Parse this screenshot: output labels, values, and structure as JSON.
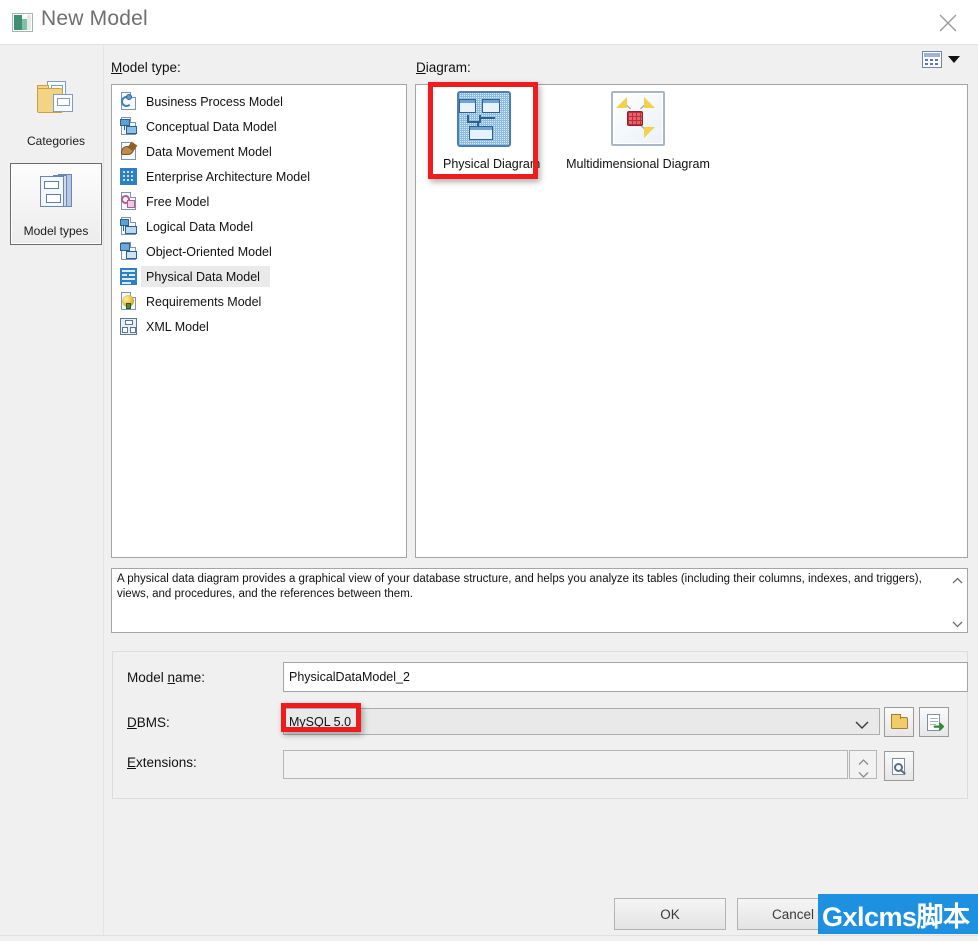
{
  "window": {
    "title": "New Model",
    "title_icon": "model-icon",
    "close_icon": "close-icon"
  },
  "view_mode": {
    "icon": "list-view-icon",
    "arrow_icon": "chevron-down-icon"
  },
  "rail": {
    "items": [
      {
        "label": "Categories",
        "icon": "categories-folder-icon",
        "selected": false
      },
      {
        "label": "Model types",
        "icon": "model-types-icon",
        "selected": true
      }
    ]
  },
  "model_type": {
    "label_prefix": "M",
    "label_rest": "odel type:",
    "items": [
      {
        "label": "Business Process Model",
        "icon": "business-process-model-icon",
        "selected": false
      },
      {
        "label": "Conceptual Data Model",
        "icon": "conceptual-data-model-icon",
        "selected": false
      },
      {
        "label": "Data Movement Model",
        "icon": "data-movement-model-icon",
        "selected": false
      },
      {
        "label": "Enterprise Architecture Model",
        "icon": "enterprise-architecture-model-icon",
        "selected": false
      },
      {
        "label": "Free Model",
        "icon": "free-model-icon",
        "selected": false
      },
      {
        "label": "Logical Data Model",
        "icon": "logical-data-model-icon",
        "selected": false
      },
      {
        "label": "Object-Oriented Model",
        "icon": "object-oriented-model-icon",
        "selected": false
      },
      {
        "label": "Physical Data Model",
        "icon": "physical-data-model-icon",
        "selected": true
      },
      {
        "label": "Requirements Model",
        "icon": "requirements-model-icon",
        "selected": false
      },
      {
        "label": "XML Model",
        "icon": "xml-model-icon",
        "selected": false
      }
    ]
  },
  "diagram": {
    "label_prefix": "D",
    "label_rest": "iagram:",
    "items": [
      {
        "label": "Physical Diagram",
        "icon": "physical-diagram-icon",
        "selected": true,
        "annotated": true
      },
      {
        "label": "Multidimensional Diagram",
        "icon": "multidimensional-diagram-icon",
        "selected": false,
        "annotated": false
      }
    ]
  },
  "description": {
    "text": "A physical data diagram provides a graphical view of your database structure, and helps you analyze its tables (including their columns, indexes, and triggers), views, and procedures, and the references between them."
  },
  "form": {
    "model_name": {
      "label_prefix": "Model ",
      "label_mid": "n",
      "label_rest": "ame:",
      "value": "PhysicalDataModel_2"
    },
    "dbms": {
      "label_prefix": "D",
      "label_rest": "BMS:",
      "value": "MySQL 5.0",
      "annotated": true,
      "browse_icon": "folder-icon",
      "import_icon": "import-page-icon"
    },
    "extensions": {
      "label_prefix": "E",
      "label_rest": "xtensions:",
      "value": "",
      "spinner_icon": "spinner-icon",
      "props_icon": "magnify-page-icon"
    }
  },
  "footer": {
    "ok_label": "OK",
    "cancel_label": "Cancel"
  },
  "watermark": {
    "text": "Gxlcms脚本",
    "color": "#1e90e0"
  },
  "colors": {
    "annotation_red": "#ee1c1c",
    "dialog_bg": "#f0f0f0",
    "panel_bg": "#ffffff"
  }
}
